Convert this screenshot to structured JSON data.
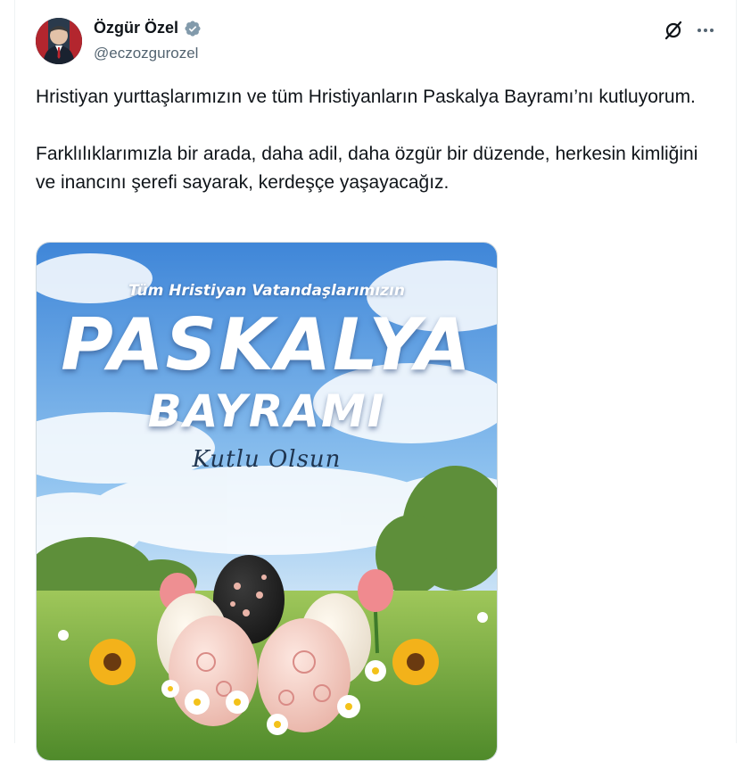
{
  "author": {
    "display_name": "Özgür Özel",
    "handle": "@eczozgurozel",
    "verified": true,
    "avatar_icon": "profile-photo"
  },
  "actions": {
    "grok_icon": "grok-icon",
    "more_icon": "more-icon"
  },
  "tweet": {
    "paragraphs": [
      "Hristiyan yurttaşlarımızın ve tüm Hristiyanların Paskalya Bayramı’nı kutluyorum.",
      "Farklılıklarımızla bir arada, daha adil, daha özgür bir düzende, herkesin kimliğini ve inancını şerefi sayarak, kerdeşçe yaşayacağız."
    ]
  },
  "media": {
    "subtitle": "Tüm Hristiyan Vatandaşlarımızın",
    "title_line1": "PASKALYA",
    "title_line2": "BAYRAMI",
    "script": "Kutlu Olsun"
  },
  "colors": {
    "verified_badge": "#829aab",
    "text_primary": "#0f1419",
    "text_secondary": "#536471"
  }
}
